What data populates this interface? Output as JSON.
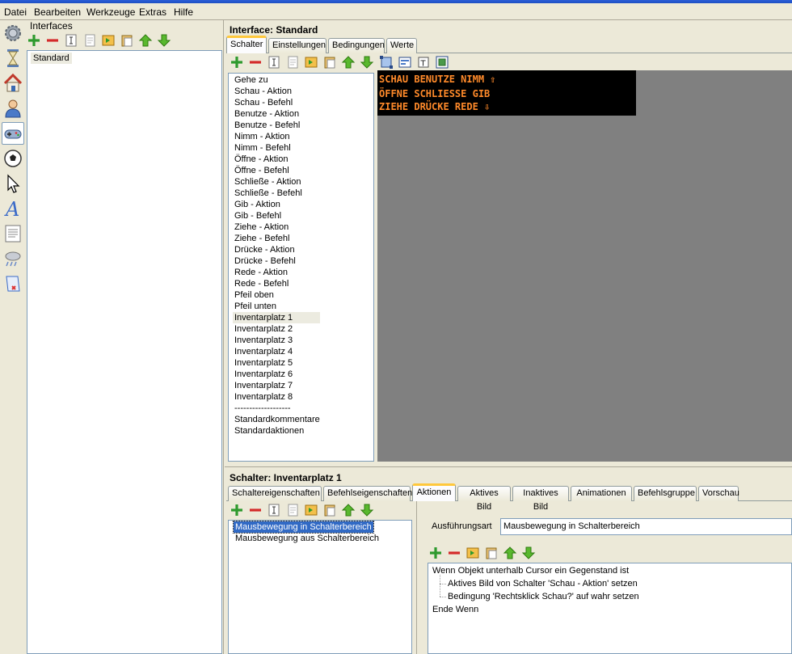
{
  "menu": [
    "Datei",
    "Bearbeiten",
    "Werkzeuge",
    "Extras",
    "Hilfe"
  ],
  "side_icons": [
    "gear-icon",
    "hourglass-icon",
    "house-icon",
    "person-icon",
    "gamepad-icon",
    "ball-icon",
    "cursor-arrow-icon",
    "font-a-icon",
    "text-page-icon",
    "weather-icon",
    "script-icon"
  ],
  "interfaces_panel": {
    "title": "Interfaces",
    "items": [
      "Standard"
    ]
  },
  "interface": {
    "title": "Interface: Standard",
    "tabs": [
      "Schalter",
      "Einstellungen",
      "Bedingungen",
      "Werte"
    ],
    "active_tab": "Schalter",
    "buttons": [
      "Gehe zu",
      "Schau - Aktion",
      "Schau - Befehl",
      "Benutze - Aktion",
      "Benutze - Befehl",
      "Nimm - Aktion",
      "Nimm - Befehl",
      "Öffne - Aktion",
      "Öffne - Befehl",
      "Schließe - Aktion",
      "Schließe - Befehl",
      "Gib - Aktion",
      "Gib - Befehl",
      "Ziehe - Aktion",
      "Ziehe - Befehl",
      "Drücke - Aktion",
      "Drücke - Befehl",
      "Rede - Aktion",
      "Rede - Befehl",
      "Pfeil oben",
      "Pfeil unten",
      "Inventarplatz 1",
      "Inventarplatz 2",
      "Inventarplatz 3",
      "Inventarplatz 4",
      "Inventarplatz 5",
      "Inventarplatz 6",
      "Inventarplatz 7",
      "Inventarplatz 8",
      "-------------------",
      "Standardkommentare",
      "Standardaktionen"
    ],
    "selected_button": "Inventarplatz 1",
    "preview_rows": [
      {
        "text": "SCHAU BENUTZE NIMM",
        "arrow": "⇧"
      },
      {
        "text": "ÖFFNE SCHLIESSE  GIB",
        "arrow": ""
      },
      {
        "text": "ZIEHE DRÜCKE  REDE",
        "arrow": "⇩"
      }
    ]
  },
  "switch": {
    "title": "Schalter: Inventarplatz 1",
    "tabs": [
      "Schaltereigenschaften",
      "Befehlseigenschaften",
      "Aktionen",
      "Aktives Bild",
      "Inaktives Bild",
      "Animationen",
      "Befehlsgruppe",
      "Vorschau"
    ],
    "active_tab": "Aktionen",
    "events": [
      "Mausbewegung in Schalterbereich",
      "Mausbewegung aus Schalterbereich"
    ],
    "selected_event": "Mausbewegung in Schalterbereich",
    "exec_label": "Ausführungsart",
    "exec_value": "Mausbewegung in Schalterbereich",
    "script": [
      {
        "text": "Wenn Objekt unterhalb Cursor ein Gegenstand ist",
        "indent": 0
      },
      {
        "text": "Aktives Bild von Schalter 'Schau - Aktion' setzen",
        "indent": 1
      },
      {
        "text": "Bedingung 'Rechtsklick Schau?' auf wahr setzen",
        "indent": 1
      },
      {
        "text": "Ende Wenn",
        "indent": 0
      }
    ]
  },
  "toolbar_icons": [
    "add-icon",
    "remove-icon",
    "rename-icon",
    "copy-icon",
    "paste-special-icon",
    "paste-icon",
    "move-up-icon",
    "move-down-icon"
  ],
  "colors": {
    "accent": "#316ac5",
    "preview_text": "#ff8a2a",
    "tab_highlight": "#ffc83c"
  }
}
